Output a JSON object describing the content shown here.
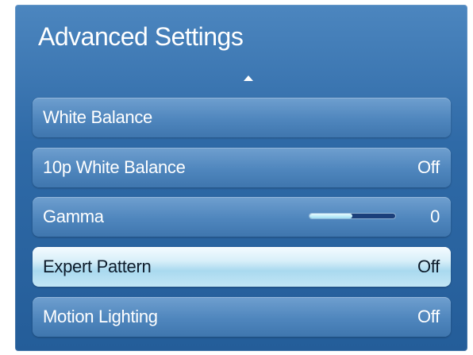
{
  "panel": {
    "title": "Advanced Settings"
  },
  "icons": {
    "scroll_up": "up-arrow-icon"
  },
  "menu": {
    "items": [
      {
        "label": "White Balance",
        "value": ""
      },
      {
        "label": "10p White Balance",
        "value": "Off"
      },
      {
        "label": "Gamma",
        "value": "0",
        "slider_fraction": 0.5
      },
      {
        "label": "Expert Pattern",
        "value": "Off",
        "selected": true
      },
      {
        "label": "Motion Lighting",
        "value": "Off"
      }
    ]
  },
  "colors": {
    "panel_background": "#2f6aa7",
    "item_background": "#4f86bd",
    "selected_item_background": "#c3e6f5",
    "slider_track": "#1b3f7a",
    "slider_fill": "#9fe0f4"
  }
}
